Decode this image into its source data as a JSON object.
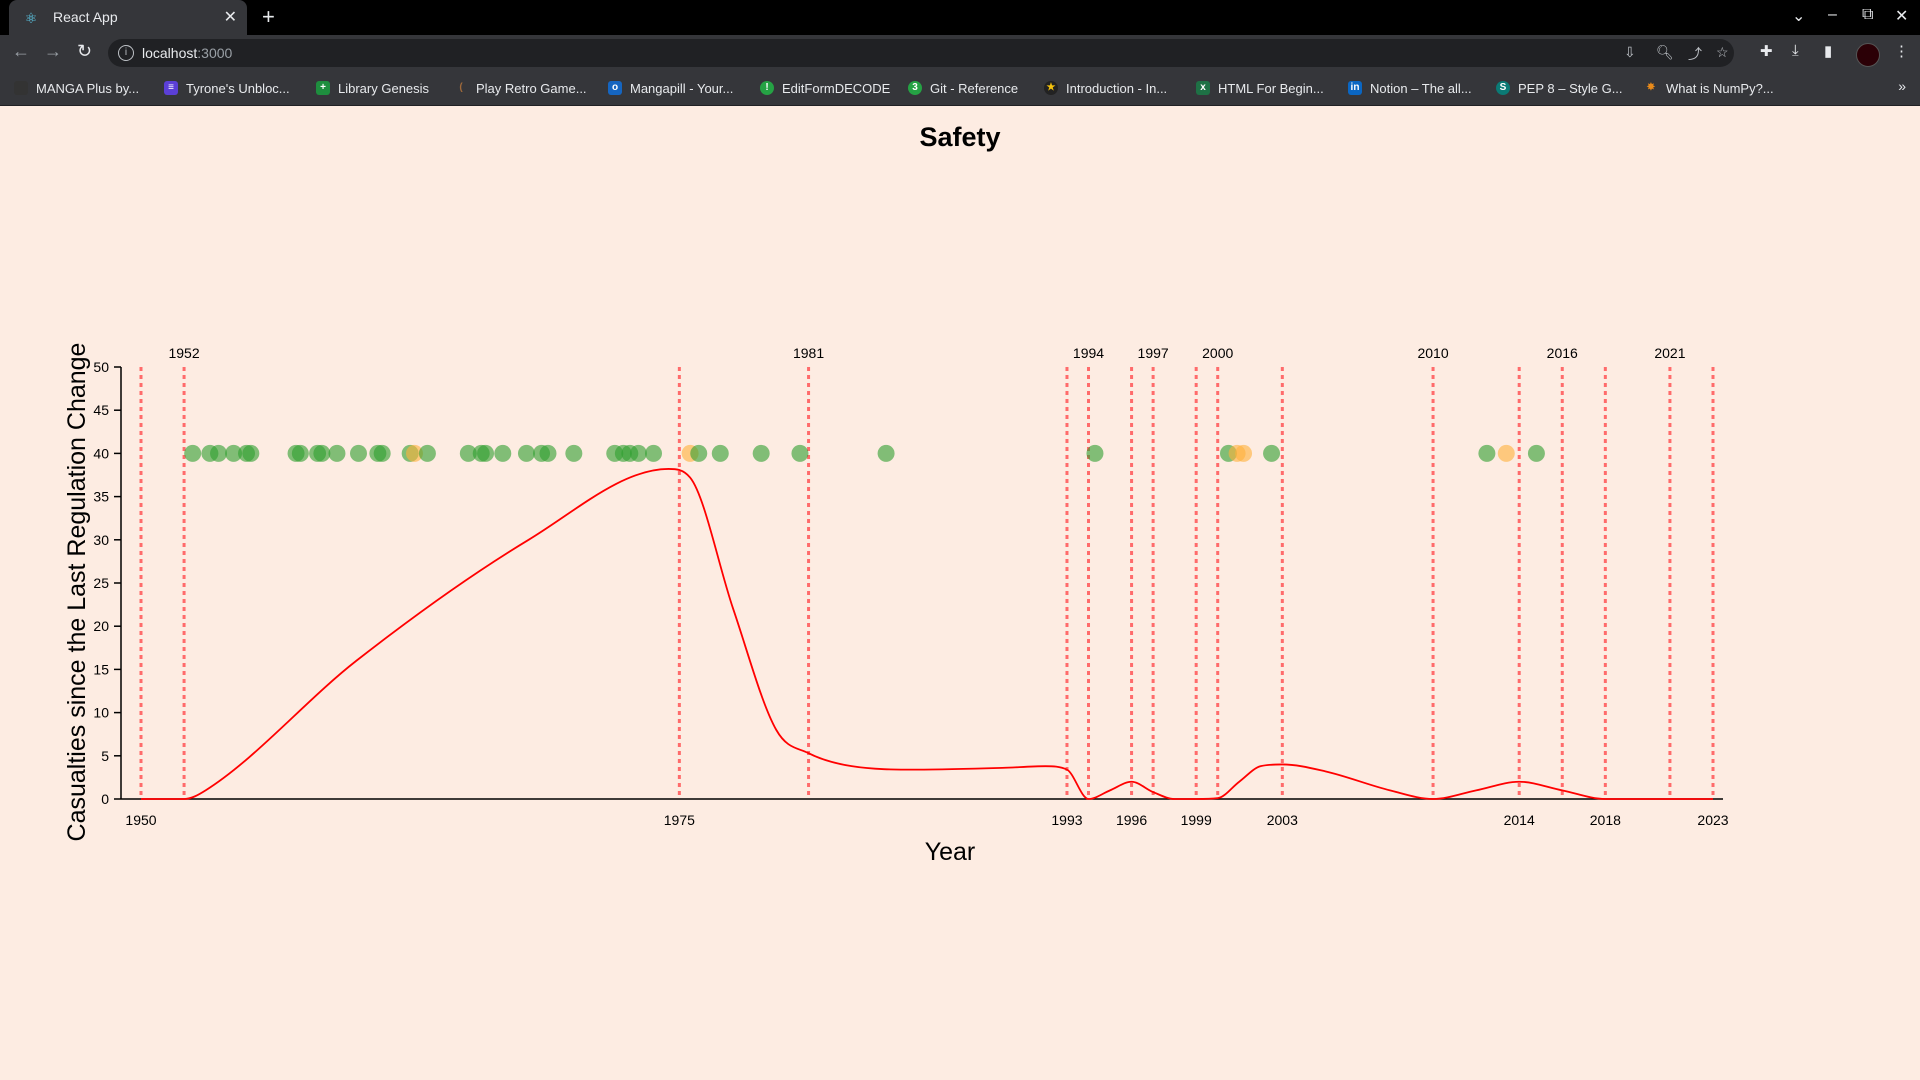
{
  "browser": {
    "tab_title": "React App",
    "url_host": "localhost",
    "url_port": ":3000",
    "bookmarks": [
      {
        "label": "MANGA Plus by...",
        "icon": "manga-plus-icon",
        "color": "#333333"
      },
      {
        "label": "Tyrone's Unbloc...",
        "icon": "tyrone-icon",
        "color": "#5b3fd6"
      },
      {
        "label": "Library Genesis",
        "icon": "library-genesis-icon",
        "color": "#1e8e3e"
      },
      {
        "label": "Play Retro Game...",
        "icon": "retro-games-icon",
        "color": "#7a4a2a"
      },
      {
        "label": "Mangapill - Your...",
        "icon": "mangapill-icon",
        "color": "#1565c0"
      },
      {
        "label": "EditFormDECODE",
        "icon": "editform-icon",
        "color": "#25a244"
      },
      {
        "label": "Git - Reference",
        "icon": "git-icon",
        "color": "#25a244"
      },
      {
        "label": "Introduction - In...",
        "icon": "introduction-icon",
        "color": "#222222"
      },
      {
        "label": "HTML For Begin...",
        "icon": "html-excel-icon",
        "color": "#1e7145"
      },
      {
        "label": "Notion – The all...",
        "icon": "linkedin-icon",
        "color": "#0a66c2"
      },
      {
        "label": "PEP 8 – Style G...",
        "icon": "pep8-icon",
        "color": "#0b7a75"
      },
      {
        "label": "What is NumPy?...",
        "icon": "numpy-icon",
        "color": "#e88a1a"
      }
    ]
  },
  "chart_data": {
    "type": "line",
    "title": "Safety",
    "xlabel": "Year",
    "ylabel": "Casualties since the Last Regulation Change",
    "xlim": [
      1950,
      2023
    ],
    "ylim": [
      0,
      50
    ],
    "yticks": [
      0,
      5,
      10,
      15,
      20,
      25,
      30,
      35,
      40,
      45,
      50
    ],
    "xticks_bottom": [
      1950,
      1975,
      1993,
      1996,
      1999,
      2003,
      2014,
      2018,
      2023
    ],
    "xticks_top": [
      1952,
      1981,
      1994,
      1997,
      2000,
      2010,
      2016,
      2021
    ],
    "regulation_lines": [
      1950,
      1952,
      1975,
      1981,
      1993,
      1994,
      1996,
      1997,
      1999,
      2000,
      2003,
      2010,
      2014,
      2016,
      2018,
      2021,
      2023
    ],
    "line_color": "#ff0000",
    "regulation_line_color": "#ff6b6b",
    "curve": {
      "x": [
        1950,
        1952,
        1953,
        1960,
        1968,
        1974.5,
        1975.5,
        1977.5,
        1979.5,
        1981,
        1983,
        1986,
        1990,
        1992,
        1993,
        1994,
        1995,
        1996,
        1997,
        1998,
        1999,
        2000,
        2001,
        2002,
        2003,
        2005,
        2008,
        2010,
        2012,
        2014,
        2016,
        2018,
        2021,
        2023
      ],
      "y": [
        0,
        0,
        1,
        16,
        30,
        38.2,
        37.2,
        22,
        8,
        5.3,
        3.8,
        3.4,
        3.6,
        3.8,
        3.4,
        0,
        1,
        2,
        0.8,
        0,
        0,
        0.1,
        2,
        3.8,
        4,
        3.2,
        1,
        0,
        1,
        2,
        1,
        0,
        0,
        0
      ]
    },
    "incidents": {
      "y": 40,
      "fatal_color": "#2f9e2f",
      "nonfatal_color": "#ffb03a",
      "points": [
        {
          "x": 1952.4,
          "c": "g"
        },
        {
          "x": 1953.2,
          "c": "g"
        },
        {
          "x": 1953.6,
          "c": "g"
        },
        {
          "x": 1954.3,
          "c": "g"
        },
        {
          "x": 1954.9,
          "c": "g"
        },
        {
          "x": 1955.1,
          "c": "g"
        },
        {
          "x": 1957.2,
          "c": "g"
        },
        {
          "x": 1957.4,
          "c": "g"
        },
        {
          "x": 1958.2,
          "c": "g"
        },
        {
          "x": 1958.4,
          "c": "g"
        },
        {
          "x": 1959.1,
          "c": "g"
        },
        {
          "x": 1960.1,
          "c": "g"
        },
        {
          "x": 1961.0,
          "c": "g"
        },
        {
          "x": 1961.2,
          "c": "g"
        },
        {
          "x": 1962.5,
          "c": "g"
        },
        {
          "x": 1962.7,
          "c": "o"
        },
        {
          "x": 1963.3,
          "c": "g"
        },
        {
          "x": 1965.2,
          "c": "g"
        },
        {
          "x": 1965.8,
          "c": "g"
        },
        {
          "x": 1966.0,
          "c": "g"
        },
        {
          "x": 1966.8,
          "c": "g"
        },
        {
          "x": 1967.9,
          "c": "g"
        },
        {
          "x": 1968.6,
          "c": "g"
        },
        {
          "x": 1968.9,
          "c": "g"
        },
        {
          "x": 1970.1,
          "c": "g"
        },
        {
          "x": 1972.0,
          "c": "g"
        },
        {
          "x": 1972.4,
          "c": "g"
        },
        {
          "x": 1972.7,
          "c": "g"
        },
        {
          "x": 1973.1,
          "c": "g"
        },
        {
          "x": 1973.8,
          "c": "g"
        },
        {
          "x": 1975.5,
          "c": "o"
        },
        {
          "x": 1975.9,
          "c": "g"
        },
        {
          "x": 1976.9,
          "c": "g"
        },
        {
          "x": 1978.8,
          "c": "g"
        },
        {
          "x": 1980.6,
          "c": "g"
        },
        {
          "x": 1984.6,
          "c": "g"
        },
        {
          "x": 1994.3,
          "c": "g"
        },
        {
          "x": 2000.5,
          "c": "g"
        },
        {
          "x": 2000.9,
          "c": "o"
        },
        {
          "x": 2001.2,
          "c": "o"
        },
        {
          "x": 2002.5,
          "c": "g"
        },
        {
          "x": 2012.5,
          "c": "g"
        },
        {
          "x": 2013.4,
          "c": "o"
        },
        {
          "x": 2014.8,
          "c": "g"
        }
      ]
    }
  }
}
